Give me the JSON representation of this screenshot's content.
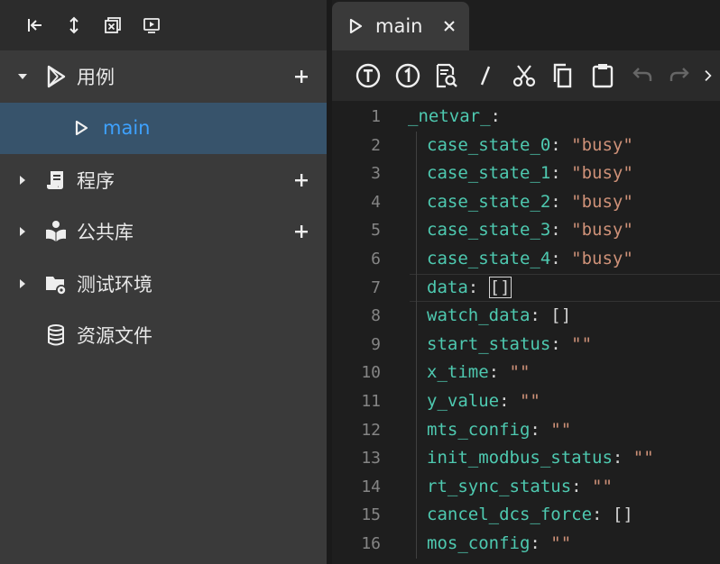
{
  "sidebar": {
    "toolbar": {
      "icons": [
        "collapse-left-icon",
        "expand-vertical-icon",
        "close-all-icon",
        "run-icon"
      ]
    },
    "tree": [
      {
        "label": "用例",
        "icon": "play-store-icon",
        "expanded": true,
        "children": [
          {
            "label": "main",
            "selected": true
          }
        ]
      },
      {
        "label": "程序",
        "icon": "script-icon",
        "expanded": false
      },
      {
        "label": "公共库",
        "icon": "book-reader-icon",
        "expanded": false
      },
      {
        "label": "测试环境",
        "icon": "folder-settings-icon",
        "expanded": false
      },
      {
        "label": "资源文件",
        "icon": "database-icon",
        "expanded": false
      }
    ]
  },
  "editor": {
    "tab": {
      "label": "main",
      "close": "×"
    },
    "toolbar_icons": [
      "step-icon",
      "step-one-icon",
      "search-doc-icon",
      "comment-slash-icon",
      "cut-icon",
      "copy-icon",
      "paste-icon",
      "undo-icon",
      "redo-icon",
      "more-icon"
    ],
    "lines": [
      {
        "n": "1",
        "tokens": [
          [
            "k",
            "_netvar_"
          ],
          [
            "p",
            ":"
          ]
        ],
        "indent": 0
      },
      {
        "n": "2",
        "tokens": [
          [
            "k",
            "case_state_0"
          ],
          [
            "p",
            ": "
          ],
          [
            "s",
            "\"busy\""
          ]
        ],
        "indent": 1
      },
      {
        "n": "3",
        "tokens": [
          [
            "k",
            "case_state_1"
          ],
          [
            "p",
            ": "
          ],
          [
            "s",
            "\"busy\""
          ]
        ],
        "indent": 1
      },
      {
        "n": "4",
        "tokens": [
          [
            "k",
            "case_state_2"
          ],
          [
            "p",
            ": "
          ],
          [
            "s",
            "\"busy\""
          ]
        ],
        "indent": 1
      },
      {
        "n": "5",
        "tokens": [
          [
            "k",
            "case_state_3"
          ],
          [
            "p",
            ": "
          ],
          [
            "s",
            "\"busy\""
          ]
        ],
        "indent": 1
      },
      {
        "n": "6",
        "tokens": [
          [
            "k",
            "case_state_4"
          ],
          [
            "p",
            ": "
          ],
          [
            "s",
            "\"busy\""
          ]
        ],
        "indent": 1
      },
      {
        "n": "7",
        "tokens": [
          [
            "k",
            "data"
          ],
          [
            "p",
            ": "
          ],
          [
            "p",
            "[]"
          ]
        ],
        "indent": 1,
        "current": true
      },
      {
        "n": "8",
        "tokens": [
          [
            "k",
            "watch_data"
          ],
          [
            "p",
            ": "
          ],
          [
            "p",
            "[]"
          ]
        ],
        "indent": 1
      },
      {
        "n": "9",
        "tokens": [
          [
            "k",
            "start_status"
          ],
          [
            "p",
            ": "
          ],
          [
            "s",
            "\"\""
          ]
        ],
        "indent": 1
      },
      {
        "n": "10",
        "tokens": [
          [
            "k",
            "x_time"
          ],
          [
            "p",
            ": "
          ],
          [
            "s",
            "\"\""
          ]
        ],
        "indent": 1
      },
      {
        "n": "11",
        "tokens": [
          [
            "k",
            "y_value"
          ],
          [
            "p",
            ": "
          ],
          [
            "s",
            "\"\""
          ]
        ],
        "indent": 1
      },
      {
        "n": "12",
        "tokens": [
          [
            "k",
            "mts_config"
          ],
          [
            "p",
            ": "
          ],
          [
            "s",
            "\"\""
          ]
        ],
        "indent": 1
      },
      {
        "n": "13",
        "tokens": [
          [
            "k",
            "init_modbus_status"
          ],
          [
            "p",
            ": "
          ],
          [
            "s",
            "\"\""
          ]
        ],
        "indent": 1
      },
      {
        "n": "14",
        "tokens": [
          [
            "k",
            "rt_sync_status"
          ],
          [
            "p",
            ": "
          ],
          [
            "s",
            "\"\""
          ]
        ],
        "indent": 1
      },
      {
        "n": "15",
        "tokens": [
          [
            "k",
            "cancel_dcs_force"
          ],
          [
            "p",
            ": "
          ],
          [
            "p",
            "[]"
          ]
        ],
        "indent": 1
      },
      {
        "n": "16",
        "tokens": [
          [
            "k",
            "mos_config"
          ],
          [
            "p",
            ": "
          ],
          [
            "s",
            "\"\""
          ]
        ],
        "indent": 1
      }
    ]
  },
  "colors": {
    "sidebar_bg": "#3a3a3a",
    "selected_bg": "#37536b",
    "selected_text": "#3ea2ff",
    "key": "#4ec9b0",
    "string": "#ce9178"
  }
}
